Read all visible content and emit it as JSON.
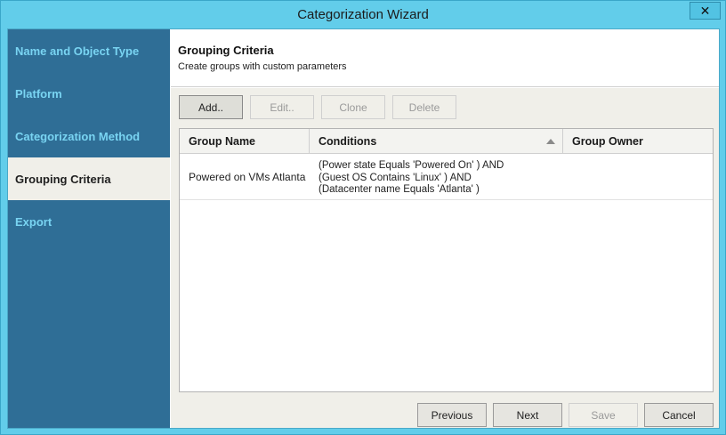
{
  "window": {
    "title": "Categorization Wizard",
    "close_glyph": "✕"
  },
  "sidebar": {
    "items": [
      {
        "label": "Name and Object Type"
      },
      {
        "label": "Platform"
      },
      {
        "label": "Categorization Method"
      },
      {
        "label": "Grouping Criteria"
      },
      {
        "label": "Export"
      }
    ],
    "active_index": 3
  },
  "header": {
    "title": "Grouping Criteria",
    "subtitle": "Create groups with custom parameters"
  },
  "toolbar": {
    "add": "Add..",
    "edit": "Edit..",
    "clone": "Clone",
    "delete": "Delete"
  },
  "table": {
    "columns": [
      "Group Name",
      "Conditions",
      "Group Owner"
    ],
    "sort": {
      "column": "Conditions",
      "direction": "ascending"
    },
    "rows": [
      {
        "name": "Powered on VMs Atlanta",
        "conditions": [
          "(Power state Equals 'Powered On' ) AND",
          "(Guest OS Contains 'Linux' ) AND",
          "(Datacenter name Equals 'Atlanta' )"
        ],
        "owner": ""
      }
    ]
  },
  "footer": {
    "previous": "Previous",
    "next": "Next",
    "save": "Save",
    "cancel": "Cancel"
  },
  "colors": {
    "title_bar": "#62cdea",
    "sidebar": "#2f6e96",
    "sidebar_text": "#79d4f2",
    "panel": "#f0efe9"
  }
}
